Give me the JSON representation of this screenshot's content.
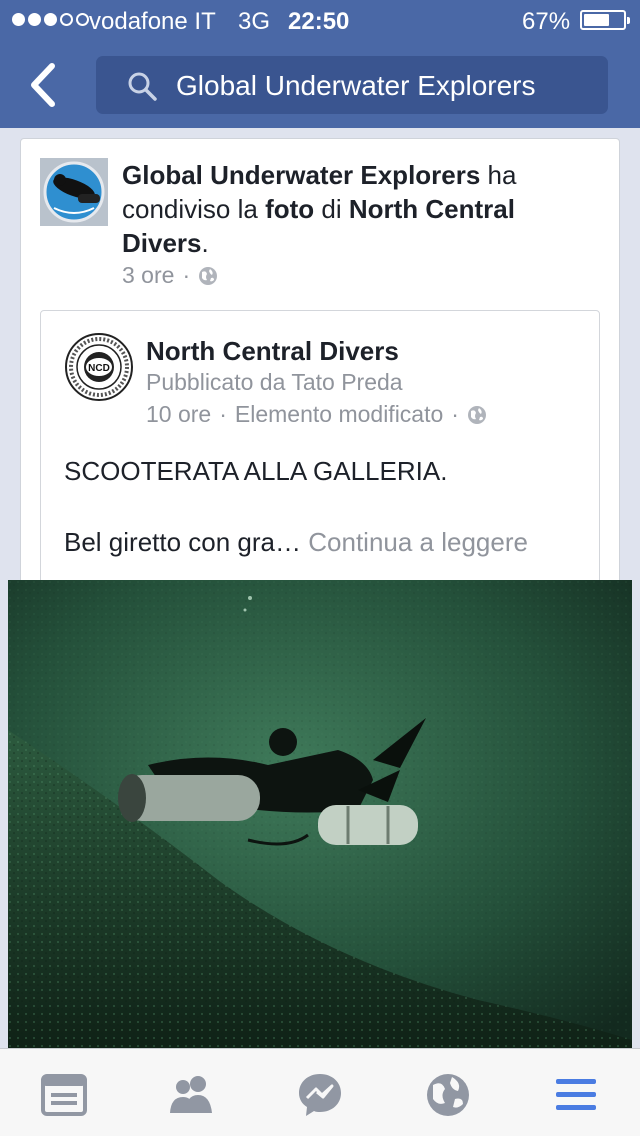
{
  "status_bar": {
    "carrier": "vodafone IT",
    "network": "3G",
    "time": "22:50",
    "battery": "67%",
    "battery_level": 0.67,
    "signal_bars_filled": 3,
    "signal_bars_total": 5
  },
  "nav": {
    "back_icon": "chevron-left-icon",
    "search_query": "Global Underwater Explorers"
  },
  "story": {
    "actor": "Global Underwater Explorers",
    "action_1": " ha condiviso la ",
    "object": "foto",
    "action_2": " di ",
    "target": "North Central Divers",
    "end": ".",
    "time": "3 ore",
    "separator": "·",
    "privacy_icon": "globe-icon"
  },
  "shared_post": {
    "page_name": "North Central Divers",
    "posted_by": "Pubblicato da Tato Preda",
    "time": "10 ore",
    "separator": "·",
    "edited": "Elemento modificato",
    "text_line1": "SCOOTERATA ALLA GALLERIA.",
    "text_preview": "Bel giretto con gra…",
    "continue_label": "Continua a leggere",
    "logo_text": "NCD"
  },
  "tabbar": {
    "items": [
      {
        "name": "news-feed",
        "icon": "news-feed-icon",
        "active": false
      },
      {
        "name": "friends",
        "icon": "friends-icon",
        "active": false
      },
      {
        "name": "messenger",
        "icon": "messenger-icon",
        "active": false
      },
      {
        "name": "notifications",
        "icon": "globe-icon",
        "active": false
      },
      {
        "name": "more",
        "icon": "menu-icon",
        "active": true
      }
    ]
  },
  "colors": {
    "header": "#4a68a6",
    "search_bg": "#3a5590",
    "tab_inactive": "#9197a3",
    "tab_active": "#4a7ce2",
    "muted_text": "#90949c"
  }
}
